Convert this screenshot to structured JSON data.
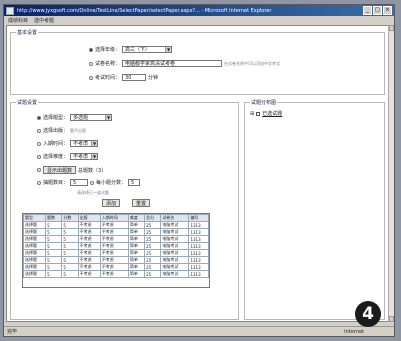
{
  "window": {
    "title": "http://www.jyxgsoft.com/Online/TestLine/SelectPaper/selectPaper.aspx?... - Microsoft Internet Explorer",
    "controls": [
      "_",
      "□",
      "×"
    ]
  },
  "menubar": {
    "items": [
      "成绩科目",
      "选中考题"
    ]
  },
  "basic": {
    "legend": "基本设置",
    "rows": [
      {
        "label": "选择年级：",
        "value": "高三（下）",
        "note": ""
      },
      {
        "label": "试卷名称：",
        "value": "电脑都学家高清试考卷",
        "note": "在试卷名称中可以添加中学考试"
      },
      {
        "label": "考试时间：",
        "value": "30",
        "note": "分钟"
      }
    ]
  },
  "select": {
    "legend": "试题设置",
    "rows": [
      {
        "label": "选择题型：",
        "value": "多选题"
      },
      {
        "label": "选择出版：",
        "value": "题不出版"
      },
      {
        "label": "入期时间：",
        "value": "不考虑"
      },
      {
        "label": "选择难度：",
        "value": "不考虑"
      }
    ],
    "show_btn": "显示出题数",
    "show_note": "总题数（3）",
    "pick_label": "抽题数目：",
    "pick_value": "5",
    "score_label": "每小题分数：",
    "score_value": "5",
    "hint": "请选择已一道试题",
    "add_btn": "添加",
    "reset_btn": "重置"
  },
  "table": {
    "headers": [
      "题型",
      "题数",
      "分数",
      "出版",
      "入期时间",
      "难度",
      "总分",
      "试卷名",
      "编号"
    ],
    "rows": [
      [
        "选择题",
        "5",
        "5",
        "不考虑",
        "不考虑",
        "简单",
        "25",
        "电脑考试",
        "1313"
      ],
      [
        "选择题",
        "5",
        "5",
        "不考虑",
        "不考虑",
        "简单",
        "25",
        "电脑考试",
        "1313"
      ],
      [
        "选择题",
        "5",
        "5",
        "不考虑",
        "不考虑",
        "简单",
        "25",
        "电脑考试",
        "1313"
      ],
      [
        "选择题",
        "5",
        "5",
        "不考虑",
        "不考虑",
        "简单",
        "25",
        "电脑考试",
        "1313"
      ],
      [
        "选择题",
        "5",
        "5",
        "不考虑",
        "不考虑",
        "简单",
        "25",
        "电脑考试",
        "1313"
      ],
      [
        "选择题",
        "5",
        "5",
        "不考虑",
        "不考虑",
        "简单",
        "25",
        "电脑考试",
        "1313"
      ],
      [
        "选择题",
        "5",
        "5",
        "不考虑",
        "不考虑",
        "简单",
        "25",
        "电脑考试",
        "1313"
      ],
      [
        "选择题",
        "5",
        "5",
        "不考虑",
        "不考虑",
        "简单",
        "25",
        "电脑考试",
        "1313"
      ]
    ]
  },
  "right_panel": {
    "legend": "试题分布图",
    "tree_item": "已选试题"
  },
  "status": {
    "left": "完毕",
    "right": "Internet"
  },
  "badge": "4"
}
